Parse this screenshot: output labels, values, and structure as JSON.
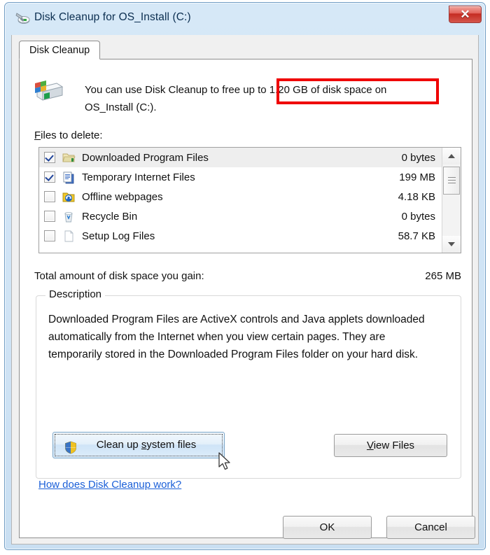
{
  "window": {
    "title": "Disk Cleanup for OS_Install (C:)",
    "title_icon": "disk-cleanup-icon",
    "close_glyph": "✕"
  },
  "tabs": [
    {
      "label": "Disk Cleanup",
      "active": true
    }
  ],
  "header": {
    "icon": "hard-drive-icon",
    "text_before": "You can use Disk Cleanup to free ",
    "highlighted": "up to 1.20 GB of disk space",
    "text_after": " on",
    "text_line2": "OS_Install (C:).",
    "highlight_color": "#ef0000"
  },
  "files_section": {
    "label_accel": "F",
    "label_rest": "iles to delete:",
    "columns": [
      "name",
      "size"
    ],
    "rows": [
      {
        "checked": true,
        "icon": "folder-downloaded-icon",
        "name": "Downloaded Program Files",
        "size": "0 bytes",
        "selected": true
      },
      {
        "checked": true,
        "icon": "documents-pages-icon",
        "name": "Temporary Internet Files",
        "size": "199 MB",
        "selected": false
      },
      {
        "checked": false,
        "icon": "offline-webpages-icon",
        "name": "Offline webpages",
        "size": "4.18 KB",
        "selected": false
      },
      {
        "checked": false,
        "icon": "recycle-bin-icon",
        "name": "Recycle Bin",
        "size": "0 bytes",
        "selected": false
      },
      {
        "checked": false,
        "icon": "blank-page-icon",
        "name": "Setup Log Files",
        "size": "58.7 KB",
        "selected": false
      }
    ],
    "scrollbar": {
      "up_icon": "scroll-up-arrow",
      "down_icon": "scroll-down-arrow",
      "thumb": "scroll-thumb"
    }
  },
  "total": {
    "label": "Total amount of disk space you gain:",
    "value": "265 MB"
  },
  "description": {
    "legend": "Description",
    "body": "Downloaded Program Files are ActiveX controls and Java applets downloaded automatically from the Internet when you view certain pages. They are temporarily stored in the Downloaded Program Files folder on your hard disk."
  },
  "buttons": {
    "clean_up_prefix": "Clean up ",
    "clean_up_accel": "s",
    "clean_up_suffix": "ystem files",
    "clean_up_icon": "uac-shield-icon",
    "view_files_accel": "V",
    "view_files_rest": "iew Files",
    "ok": "OK",
    "cancel": "Cancel"
  },
  "help_link": {
    "label": "How does Disk Cleanup work?",
    "color": "#1a5fd8"
  }
}
